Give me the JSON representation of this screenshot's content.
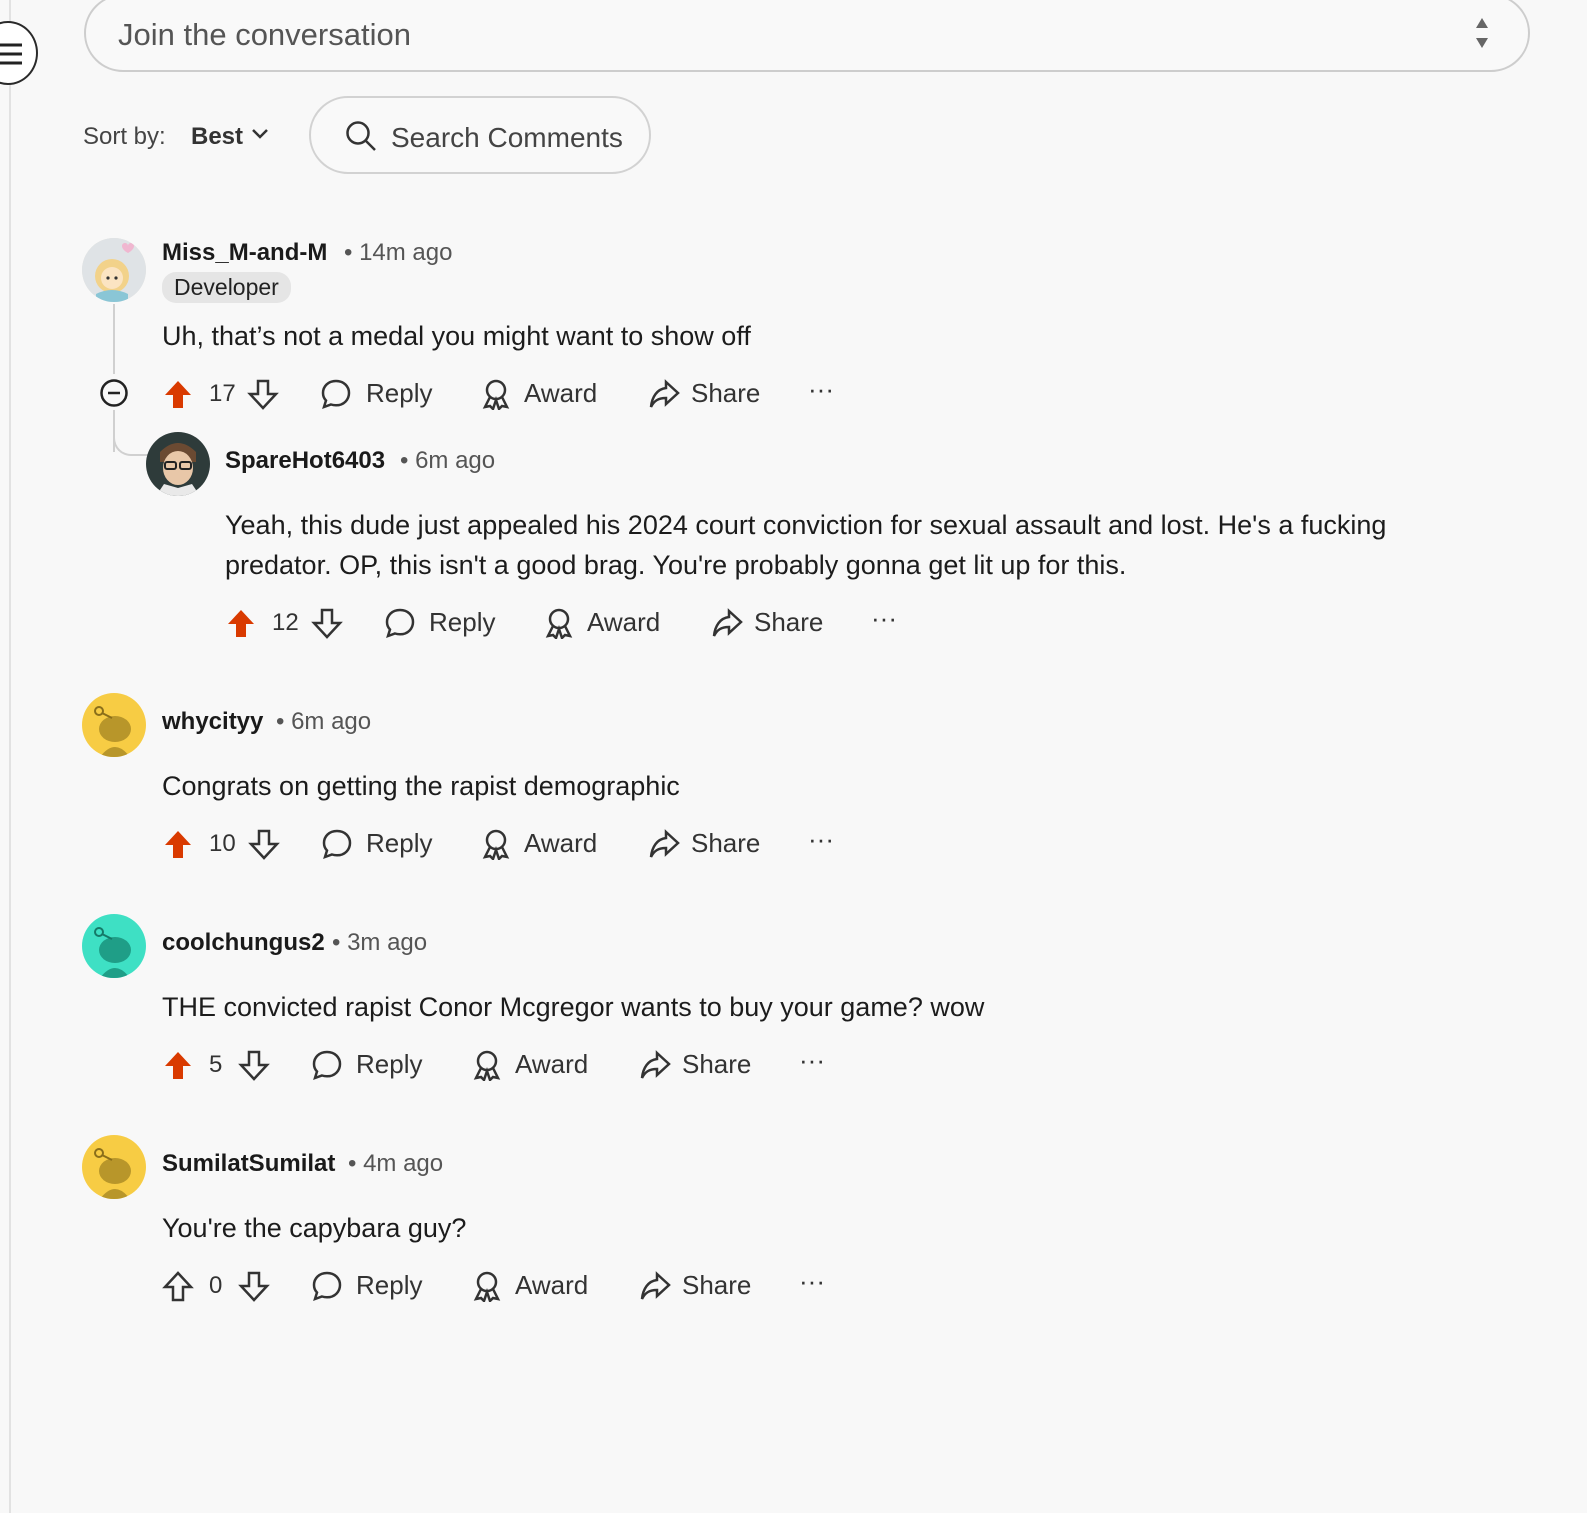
{
  "composer": {
    "placeholder": "Join the conversation"
  },
  "sort": {
    "label": "Sort by:",
    "value": "Best"
  },
  "search": {
    "placeholder": "Search Comments"
  },
  "action_labels": {
    "reply": "Reply",
    "award": "Award",
    "share": "Share",
    "more": "···"
  },
  "colors": {
    "upvote_active": "#d93a00",
    "background": "#f8f8f8",
    "text": "#1c1c1c"
  },
  "comments": [
    {
      "author": "Miss_M-and-M",
      "time": "• 14m ago",
      "flair": "Developer",
      "text": "Uh, that’s not a medal you might want to show off",
      "score": "17",
      "upvoted": true,
      "avatar": "custom-avatar"
    },
    {
      "author": "SpareHot6403",
      "time": "• 6m ago",
      "text": "Yeah, this dude just appealed his 2024 court conviction for sexual assault and lost. He's a fucking predator. OP, this isn't a good brag. You're probably gonna get lit up for this.",
      "score": "12",
      "upvoted": true,
      "avatar": "custom-avatar"
    },
    {
      "author": "whycityy",
      "time": "• 6m ago",
      "text": "Congrats on getting the rapist demographic",
      "score": "10",
      "upvoted": true,
      "avatar": "snoo-yellow"
    },
    {
      "author": "coolchungus2",
      "time": "• 3m ago",
      "text": "THE convicted rapist Conor Mcgregor wants to buy your game? wow",
      "score": "5",
      "upvoted": true,
      "avatar": "snoo-teal"
    },
    {
      "author": "SumilatSumilat",
      "time": "• 4m ago",
      "text": "You're the capybara guy?",
      "score": "0",
      "upvoted": false,
      "avatar": "snoo-yellow"
    }
  ]
}
